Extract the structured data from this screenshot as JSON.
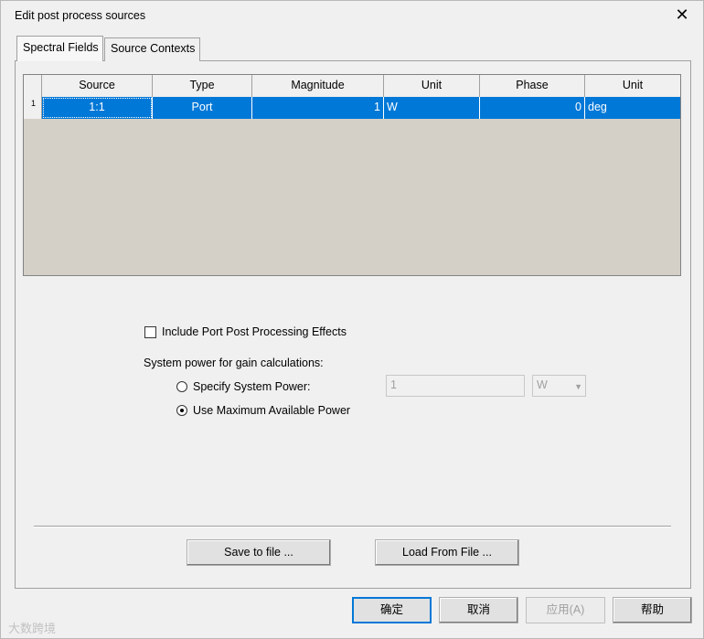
{
  "window": {
    "title": "Edit post process sources"
  },
  "tabs": [
    {
      "label": "Spectral Fields"
    },
    {
      "label": "Source Contexts"
    }
  ],
  "table": {
    "columns": [
      "Source",
      "Type",
      "Magnitude",
      "Unit",
      "Phase",
      "Unit"
    ],
    "rows": [
      {
        "index": "1",
        "source": "1:1",
        "type": "Port",
        "magnitude": "1",
        "unit": "W",
        "phase": "0",
        "phase_unit": "deg"
      }
    ]
  },
  "options": {
    "include_port_effects": {
      "label": "Include Port Post Processing Effects",
      "checked": false
    },
    "system_power_label": "System power for gain calculations:",
    "specify_system_power": {
      "label": "Specify System Power:",
      "checked": false
    },
    "use_max_power": {
      "label": "Use Maximum Available Power",
      "checked": true
    },
    "power_value": "1",
    "power_unit": "W"
  },
  "buttons": {
    "save": "Save to file ...",
    "load": "Load From File ...",
    "ok": "确定",
    "cancel": "取消",
    "apply": "应用(A)",
    "help": "帮助"
  },
  "watermark": "大数跨境",
  "colors": {
    "selection": "#0078d7",
    "grid_background": "#d4d0c8"
  }
}
